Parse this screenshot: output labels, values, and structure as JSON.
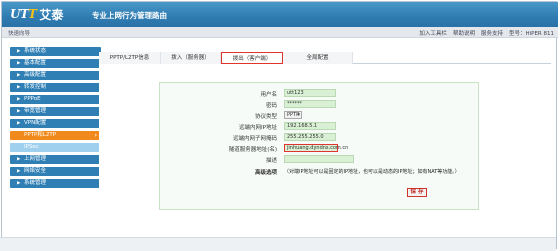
{
  "header": {
    "logo_mark_main": "UT",
    "logo_mark_accent": "T",
    "logo_cn": "艾泰",
    "slogan": "专业上网行为管理路由"
  },
  "topbar": {
    "breadcrumb": "快速向导",
    "links": [
      "加入工具栏",
      "帮助说明",
      "服务支持",
      "型号：HiPER 811"
    ]
  },
  "sidebar": {
    "items": [
      {
        "label": "系统状态"
      },
      {
        "label": "基本配置"
      },
      {
        "label": "高级配置"
      },
      {
        "label": "转发控制"
      },
      {
        "label": "PPPoE"
      },
      {
        "label": "带宽管理"
      },
      {
        "label": "VPN配置"
      },
      {
        "label": "PPTP和L2TP"
      },
      {
        "label": "IPSec"
      },
      {
        "label": "上网管理"
      },
      {
        "label": "网络安全"
      },
      {
        "label": "系统管理"
      }
    ]
  },
  "tabs": [
    {
      "label": "PPTP/L2TP信息"
    },
    {
      "label": "拨入（服务器）"
    },
    {
      "label": "拨出（客户端）"
    },
    {
      "label": "全局配置"
    }
  ],
  "form": {
    "fields": [
      {
        "label": "用户名",
        "value": "utt123"
      },
      {
        "label": "密码",
        "value": "******"
      },
      {
        "label": "协议类型",
        "value": "PPTP"
      },
      {
        "label": "远端内网IP地址",
        "value": "192.168.5.1"
      },
      {
        "label": "远端内网子网掩码",
        "value": "255.255.255.0"
      },
      {
        "label": "隧道服务器地址(名)",
        "value": "jinhuang.dyndns.com.cn"
      },
      {
        "label": "描述",
        "value": ""
      }
    ],
    "advanced_label": "高级选项",
    "advanced_text": "（对端IP地址可以是固定的IP地址，也可以是动态的IP地址；如有NAT等功能。）",
    "save_label": "保 存"
  }
}
